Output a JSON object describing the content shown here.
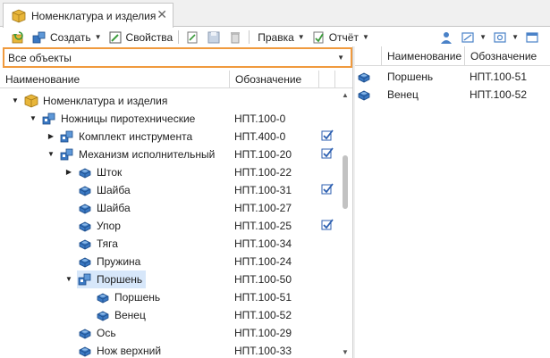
{
  "tab": {
    "title": "Номенклатура и изделия",
    "close": "✕"
  },
  "toolbar": {
    "create": "Создать",
    "properties": "Свойства",
    "edit": "Правка",
    "report": "Отчёт"
  },
  "filter": {
    "value": "Все объекты"
  },
  "left_headers": {
    "name": "Наименование",
    "code": "Обозначение"
  },
  "right_headers": {
    "name": "Наименование",
    "code": "Обозначение"
  },
  "tree": [
    {
      "name": "Номенклатура и изделия",
      "code": "",
      "checked": false,
      "level": 0,
      "expander": "open",
      "icon": "folder-box-icon"
    },
    {
      "name": "Ножницы пиротехнические",
      "code": "НПТ.100-0",
      "checked": false,
      "level": 1,
      "expander": "open",
      "icon": "assembly-icon"
    },
    {
      "name": "Комплект инструмента",
      "code": "НПТ.400-0",
      "checked": true,
      "level": 2,
      "expander": "closed",
      "icon": "assembly-icon"
    },
    {
      "name": "Механизм исполнительный",
      "code": "НПТ.100-20",
      "checked": true,
      "level": 2,
      "expander": "open",
      "icon": "assembly-icon"
    },
    {
      "name": "Шток",
      "code": "НПТ.100-22",
      "checked": false,
      "level": 3,
      "expander": "closed",
      "icon": "part-icon"
    },
    {
      "name": "Шайба",
      "code": "НПТ.100-31",
      "checked": true,
      "level": 3,
      "expander": "none",
      "icon": "part-icon"
    },
    {
      "name": "Шайба",
      "code": "НПТ.100-27",
      "checked": false,
      "level": 3,
      "expander": "none",
      "icon": "part-icon"
    },
    {
      "name": "Упор",
      "code": "НПТ.100-25",
      "checked": true,
      "level": 3,
      "expander": "none",
      "icon": "part-icon"
    },
    {
      "name": "Тяга",
      "code": "НПТ.100-34",
      "checked": false,
      "level": 3,
      "expander": "none",
      "icon": "part-icon"
    },
    {
      "name": "Пружина",
      "code": "НПТ.100-24",
      "checked": false,
      "level": 3,
      "expander": "none",
      "icon": "part-icon"
    },
    {
      "name": "Поршень",
      "code": "НПТ.100-50",
      "checked": false,
      "level": 3,
      "expander": "open",
      "icon": "assembly-icon",
      "selected": true
    },
    {
      "name": "Поршень",
      "code": "НПТ.100-51",
      "checked": false,
      "level": 4,
      "expander": "none",
      "icon": "part-icon"
    },
    {
      "name": "Венец",
      "code": "НПТ.100-52",
      "checked": false,
      "level": 4,
      "expander": "none",
      "icon": "part-icon"
    },
    {
      "name": "Ось",
      "code": "НПТ.100-29",
      "checked": false,
      "level": 3,
      "expander": "none",
      "icon": "part-icon"
    },
    {
      "name": "Нож верхний",
      "code": "НПТ.100-33",
      "checked": false,
      "level": 3,
      "expander": "none",
      "icon": "part-icon"
    }
  ],
  "right_rows": [
    {
      "name": "Поршень",
      "code": "НПТ.100-51",
      "icon": "part-icon"
    },
    {
      "name": "Венец",
      "code": "НПТ.100-52",
      "icon": "part-icon"
    }
  ],
  "colors": {
    "accent_border": "#f09a3e",
    "selection": "#d7e7fa",
    "part_blue": "#3a78c2",
    "folder_yellow": "#e8b63a"
  }
}
